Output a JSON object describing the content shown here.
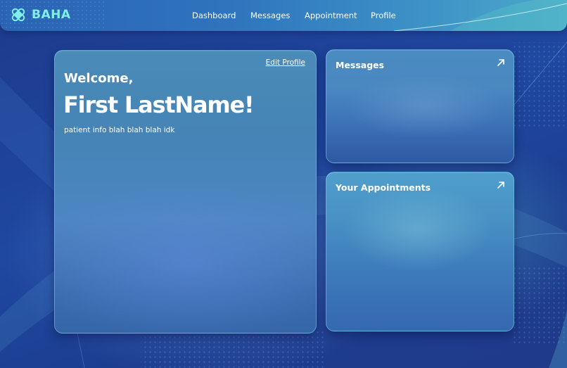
{
  "colors": {
    "accent": "#7ff0e6",
    "background": "#1f3f93",
    "navbar_start": "#2a63b4",
    "navbar_end": "#4da9c9",
    "text": "#ffffff"
  },
  "navbar": {
    "logo_icon": "bandage-icon",
    "logo_text": "BAHA",
    "links": [
      "Dashboard",
      "Messages",
      "Appointment",
      "Profile"
    ]
  },
  "welcome_card": {
    "edit_label": "Edit Profile",
    "greeting": "Welcome,",
    "name": "First LastName!",
    "info": "patient info blah blah blah idk"
  },
  "messages_card": {
    "title": "Messages",
    "icon": "arrow-up-right-icon"
  },
  "appointments_card": {
    "title": "Your Appointments",
    "icon": "arrow-up-right-icon"
  }
}
